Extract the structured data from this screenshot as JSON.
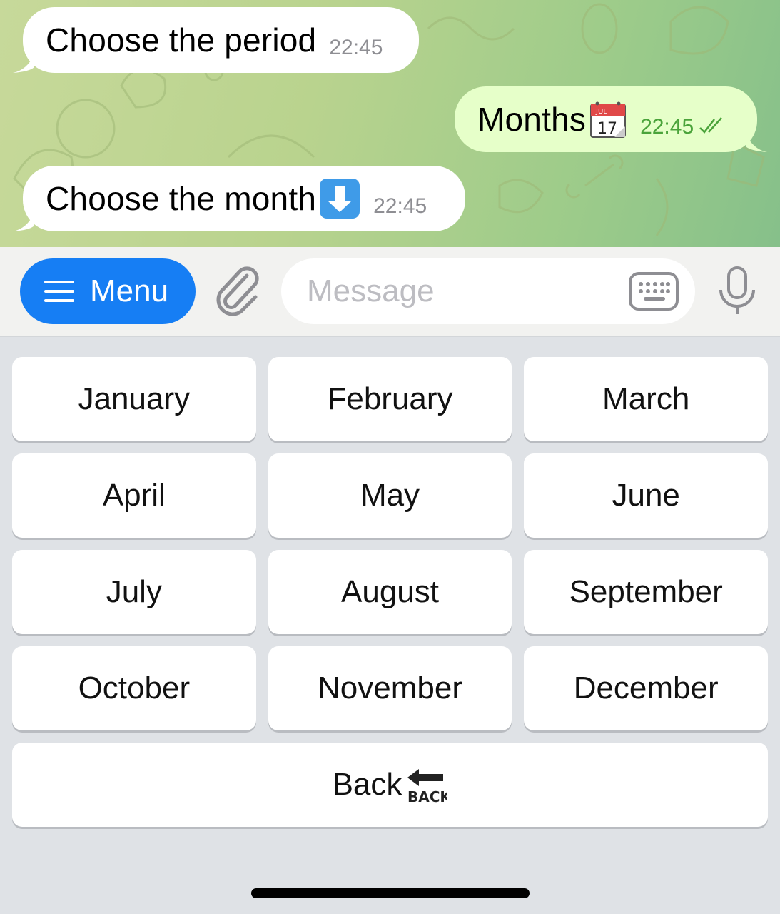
{
  "messages": [
    {
      "direction": "incoming",
      "text": "Choose the period",
      "time": "22:45"
    },
    {
      "direction": "outgoing",
      "text": "Months",
      "emoji": "calendar-icon",
      "time": "22:45",
      "status": "read-double-check"
    },
    {
      "direction": "incoming",
      "text": "Choose the month",
      "emoji": "down-arrow-emoji",
      "time": "22:45"
    }
  ],
  "input_bar": {
    "menu_label": "Menu",
    "placeholder": "Message"
  },
  "keyboard": {
    "rows": [
      [
        "January",
        "February",
        "March"
      ],
      [
        "April",
        "May",
        "June"
      ],
      [
        "July",
        "August",
        "September"
      ],
      [
        "October",
        "November",
        "December"
      ]
    ],
    "back_label": "Back",
    "back_emoji_text": "BACK"
  },
  "colors": {
    "accent": "#167ef4",
    "incoming_bubble": "#ffffff",
    "outgoing_bubble": "#e6ffc9",
    "outgoing_time": "#4aa33a"
  }
}
